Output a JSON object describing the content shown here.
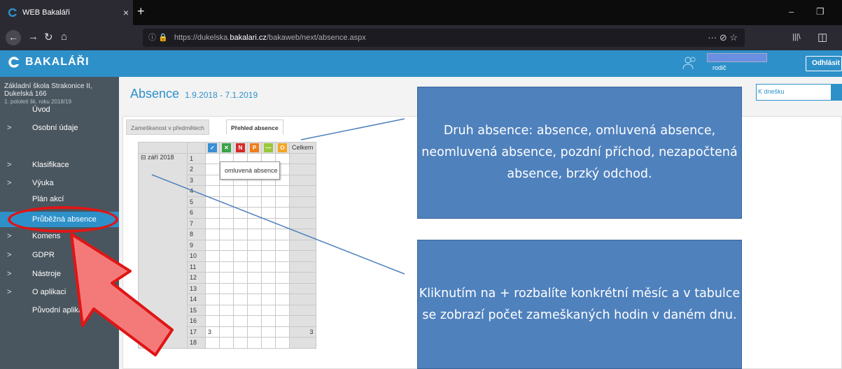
{
  "browser": {
    "tab_title": "WEB Bakaláři",
    "tab_close": "×",
    "new_tab": "+",
    "url_prefix": "https://dukelska.",
    "url_domain": "bakalari.cz",
    "url_path": "/bakaweb/next/absence.aspx",
    "url_tools": "··· ⊘ ☆",
    "minimize": "–",
    "restore": "❐",
    "library": "|||\\",
    "sidebar_btn": "◫"
  },
  "app": {
    "logo": "BAKALÁŘI",
    "user_role": "rodič",
    "logout": "Odhlásit"
  },
  "sidebar": {
    "school_name": "Základní škola Strakonice II, Dukelská 166",
    "term": "1. pololetí šk. roku 2018/19",
    "items": [
      {
        "label": "Úvod",
        "chevron": ""
      },
      {
        "label": "Osobní údaje",
        "chevron": ">"
      },
      {
        "label": "Klasifikace",
        "chevron": ">"
      },
      {
        "label": "Výuka",
        "chevron": ">"
      },
      {
        "label": "Plán akcí",
        "chevron": ""
      },
      {
        "label": "Průběžná absence",
        "chevron": ""
      },
      {
        "label": "Komens",
        "chevron": ">"
      },
      {
        "label": "GDPR",
        "chevron": ">"
      },
      {
        "label": "Nástroje",
        "chevron": ">"
      },
      {
        "label": "O aplikaci",
        "chevron": ">"
      },
      {
        "label": "Původní aplikace",
        "chevron": ""
      }
    ]
  },
  "main": {
    "title": "Absence",
    "dates": "1.9.2018 - 7.1.2019",
    "k_dnesku": "K dnešku",
    "tabs": [
      "Zameškanost v předmětech",
      "Přehled absence"
    ],
    "tooltip": "omluvená absence",
    "month": "⊟ září 2018",
    "total_header": "Celkem",
    "absence_types": [
      {
        "symbol": "✓",
        "color": "#3a8fd6"
      },
      {
        "symbol": "✕",
        "color": "#3aa34a"
      },
      {
        "symbol": "N",
        "color": "#d72a2a"
      },
      {
        "symbol": "P",
        "color": "#f07d1a"
      },
      {
        "symbol": "—",
        "color": "#9cc83a"
      },
      {
        "symbol": "O",
        "color": "#f5a623"
      }
    ],
    "days": [
      "1",
      "2",
      "3",
      "4",
      "5",
      "6",
      "7",
      "8",
      "9",
      "10",
      "11",
      "12",
      "13",
      "14",
      "15",
      "16",
      "17",
      "18"
    ],
    "day17_value": "3",
    "day17_total": "3"
  },
  "callouts": {
    "top": "Druh absence: absence, omluvená absence, neomluvená absence, pozdní příchod, nezapočtená absence, brzký odchod.",
    "bottom": "Kliknutím na + rozbalíte konkrétní měsíc a v tabulce se zobrazí počet zameškaných hodin v daném dnu."
  }
}
